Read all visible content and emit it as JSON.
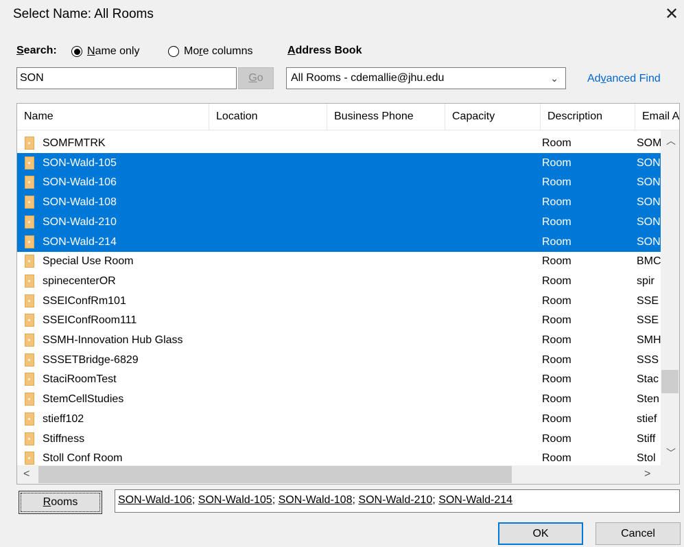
{
  "window": {
    "title": "Select Name: All Rooms"
  },
  "search": {
    "label_prefix": "S",
    "label_rest": "earch:",
    "option_name_only_u": "N",
    "option_name_only_rest": "ame only",
    "option_more_pre": "Mo",
    "option_more_u": "r",
    "option_more_rest": "e columns",
    "selected": "name-only",
    "value": "SON",
    "go_u": "G",
    "go_rest": "o"
  },
  "address_book": {
    "label_u": "A",
    "label_rest": "ddress Book",
    "selected": "All Rooms - cdemallie@jhu.edu",
    "advanced_pre": "Ad",
    "advanced_u": "v",
    "advanced_rest": "anced Find"
  },
  "columns": [
    "Name",
    "Location",
    "Business Phone",
    "Capacity",
    "Description",
    "Email A"
  ],
  "rows": [
    {
      "name": "SOMFMTRK",
      "description": "Room",
      "email": "SOM",
      "selected": false
    },
    {
      "name": "SON-Wald-105",
      "description": "Room",
      "email": "SON",
      "selected": true
    },
    {
      "name": "SON-Wald-106",
      "description": "Room",
      "email": "SON",
      "selected": true
    },
    {
      "name": "SON-Wald-108",
      "description": "Room",
      "email": "SON",
      "selected": true
    },
    {
      "name": "SON-Wald-210",
      "description": "Room",
      "email": "SON",
      "selected": true
    },
    {
      "name": "SON-Wald-214",
      "description": "Room",
      "email": "SON",
      "selected": true
    },
    {
      "name": "Special Use Room",
      "description": "Room",
      "email": "BMC",
      "selected": false
    },
    {
      "name": "spinecenterOR",
      "description": "Room",
      "email": "spir",
      "selected": false
    },
    {
      "name": "SSEIConfRm101",
      "description": "Room",
      "email": "SSE",
      "selected": false
    },
    {
      "name": "SSEIConfRoom111",
      "description": "Room",
      "email": "SSE",
      "selected": false
    },
    {
      "name": "SSMH-Innovation Hub Glass",
      "description": "Room",
      "email": "SMH",
      "selected": false
    },
    {
      "name": "SSSETBridge-6829",
      "description": "Room",
      "email": "SSS",
      "selected": false
    },
    {
      "name": "StaciRoomTest",
      "description": "Room",
      "email": "Stac",
      "selected": false
    },
    {
      "name": "StemCellStudies",
      "description": "Room",
      "email": "Sten",
      "selected": false
    },
    {
      "name": "stieff102",
      "description": "Room",
      "email": "stief",
      "selected": false
    },
    {
      "name": "Stiffness",
      "description": "Room",
      "email": "Stiff",
      "selected": false
    },
    {
      "name": "Stoll Conf Room",
      "description": "Room",
      "email": "Stol",
      "selected": false
    }
  ],
  "rooms_button": {
    "u": "R",
    "rest": "ooms"
  },
  "recipients": [
    "SON-Wald-106",
    "SON-Wald-105",
    "SON-Wald-108",
    "SON-Wald-210",
    "SON-Wald-214"
  ],
  "recipient_separator": ";",
  "buttons": {
    "ok": "OK",
    "cancel": "Cancel"
  },
  "colors": {
    "selection": "#0078d7",
    "link": "#0066cc",
    "room_icon": "#f2c378"
  }
}
